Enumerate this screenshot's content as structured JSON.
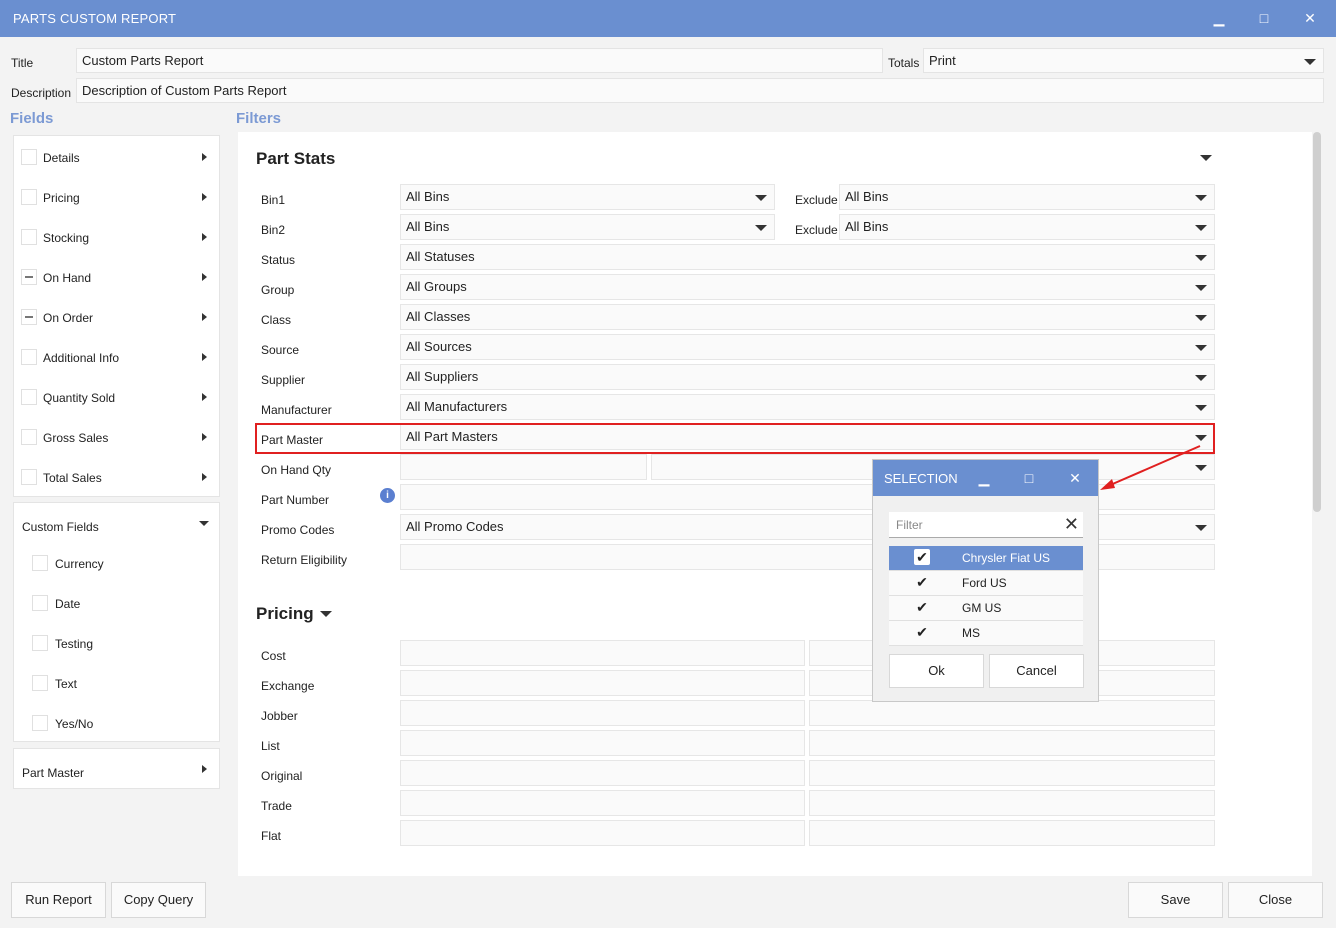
{
  "window": {
    "title": "PARTS CUSTOM REPORT",
    "minimize_glyph": "▁",
    "maximize_glyph": "□",
    "close_glyph": "✕"
  },
  "header": {
    "title_label": "Title",
    "title_value": "Custom Parts Report",
    "totals_label": "Totals",
    "totals_value": "Print",
    "description_label": "Description",
    "description_value": "Description of Custom Parts Report"
  },
  "fields": {
    "heading": "Fields",
    "items": [
      {
        "label": "Details",
        "state": "unchecked"
      },
      {
        "label": "Pricing",
        "state": "unchecked"
      },
      {
        "label": "Stocking",
        "state": "unchecked"
      },
      {
        "label": "On Hand",
        "state": "indeterminate"
      },
      {
        "label": "On Order",
        "state": "indeterminate"
      },
      {
        "label": "Additional Info",
        "state": "unchecked"
      },
      {
        "label": "Quantity Sold",
        "state": "unchecked"
      },
      {
        "label": "Gross Sales",
        "state": "unchecked"
      },
      {
        "label": "Total Sales",
        "state": "unchecked"
      }
    ],
    "custom_fields": {
      "label": "Custom Fields",
      "items": [
        "Currency",
        "Date",
        "Testing",
        "Text",
        "Yes/No"
      ]
    },
    "part_master_label": "Part Master"
  },
  "filters": {
    "heading": "Filters",
    "part_stats": {
      "title": "Part Stats",
      "exclude_label": "Exclude",
      "rows": [
        {
          "label": "Bin1",
          "value": "All Bins",
          "exclude_value": "All Bins"
        },
        {
          "label": "Bin2",
          "value": "All Bins",
          "exclude_value": "All Bins"
        },
        {
          "label": "Status",
          "value": "All Statuses"
        },
        {
          "label": "Group",
          "value": "All Groups"
        },
        {
          "label": "Class",
          "value": "All Classes"
        },
        {
          "label": "Source",
          "value": "All Sources"
        },
        {
          "label": "Supplier",
          "value": "All Suppliers"
        },
        {
          "label": "Manufacturer",
          "value": "All Manufacturers"
        },
        {
          "label": "Part Master",
          "value": "All Part Masters"
        },
        {
          "label": "On Hand Qty",
          "value": ""
        },
        {
          "label": "Part Number",
          "value": ""
        },
        {
          "label": "Promo Codes",
          "value": "All Promo Codes"
        },
        {
          "label": "Return Eligibility",
          "value": ""
        }
      ],
      "info_glyph": "i"
    },
    "pricing": {
      "title": "Pricing",
      "rows": [
        "Cost",
        "Exchange",
        "Jobber",
        "List",
        "Original",
        "Trade",
        "Flat"
      ]
    }
  },
  "footer": {
    "run_report": "Run Report",
    "copy_query": "Copy Query",
    "save": "Save",
    "close": "Close"
  },
  "selection_dialog": {
    "title": "SELECTION",
    "filter_placeholder": "Filter",
    "clear_glyph": "✕",
    "items": [
      {
        "label": "Chrysler Fiat US",
        "checked": true,
        "selected": true
      },
      {
        "label": "Ford US",
        "checked": true,
        "selected": false
      },
      {
        "label": "GM US",
        "checked": true,
        "selected": false
      },
      {
        "label": "MS",
        "checked": true,
        "selected": false
      }
    ],
    "check_glyph": "✔",
    "ok": "Ok",
    "cancel": "Cancel"
  },
  "colors": {
    "accent": "#6a8fd0",
    "highlight": "#e02020",
    "section_heading": "#7c9ad4"
  }
}
